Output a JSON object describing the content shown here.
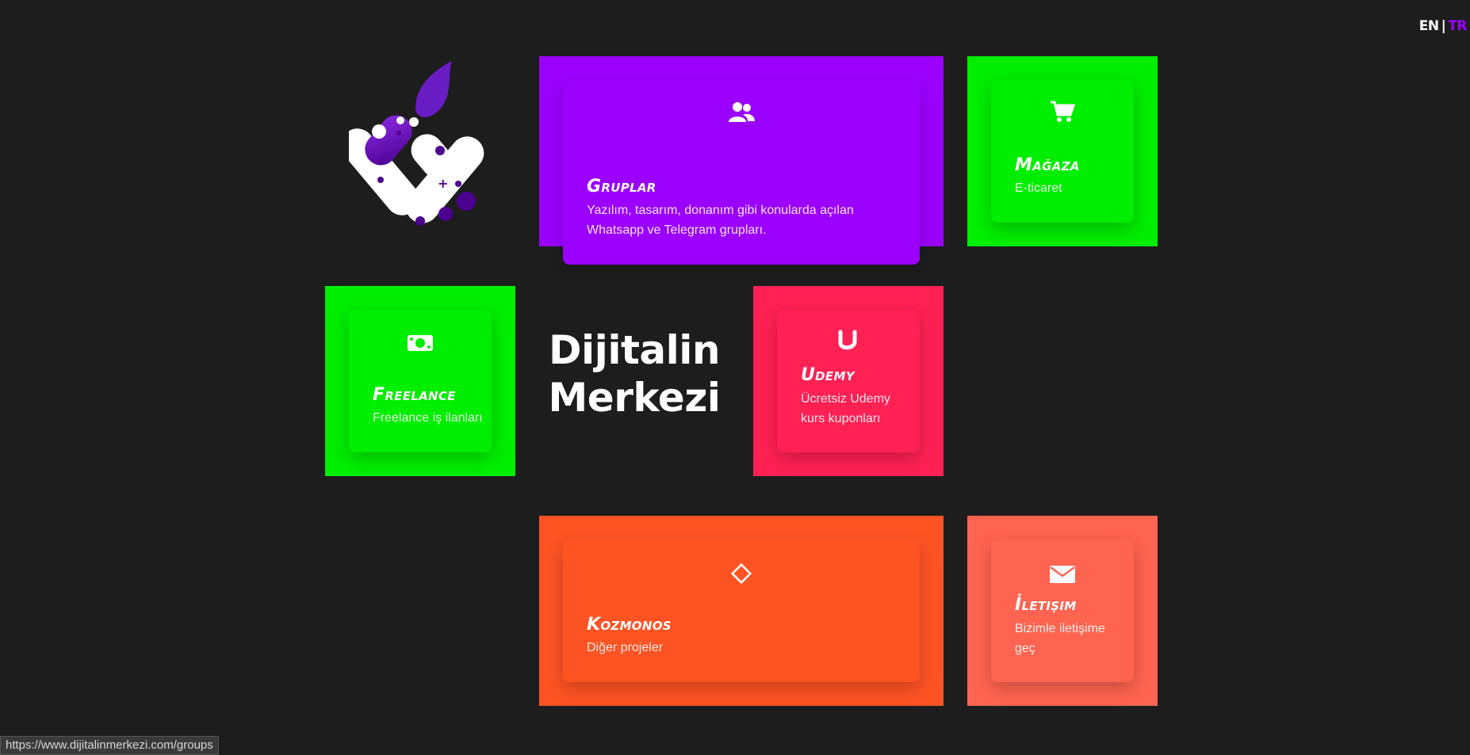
{
  "lang": {
    "en": "EN",
    "separator": "|",
    "tr": "TR"
  },
  "brand": {
    "line1": "Dijitalin",
    "line2": "Merkezi"
  },
  "tiles": {
    "groups": {
      "title": "Gruplar",
      "desc": "Yazılım, tasarım, donanım gibi konularda açılan Whatsapp ve Telegram grupları.",
      "icon": "users-icon",
      "color": "#9b00ff"
    },
    "store": {
      "title": "Mağaza",
      "desc": "E-ticaret",
      "icon": "cart-icon",
      "color": "#00ee00"
    },
    "freelance": {
      "title": "Freelance",
      "desc": "Freelance iş ilanları",
      "icon": "money-icon",
      "color": "#00ee00"
    },
    "udemy": {
      "title": "Udemy",
      "desc": "Ücretsiz Udemy kurs kuponları",
      "icon": "udemy-icon",
      "color": "#ff2054"
    },
    "kozmonos": {
      "title": "Kozmonos",
      "desc": "Diğer projeler",
      "icon": "diamond-icon",
      "color": "#ff5323"
    },
    "contact": {
      "title": "İletişim",
      "desc": "Bizimle iletişime geç",
      "icon": "envelope-icon",
      "color": "#ff6450"
    }
  },
  "status_url": "https://www.dijitalinmerkezi.com/groups"
}
